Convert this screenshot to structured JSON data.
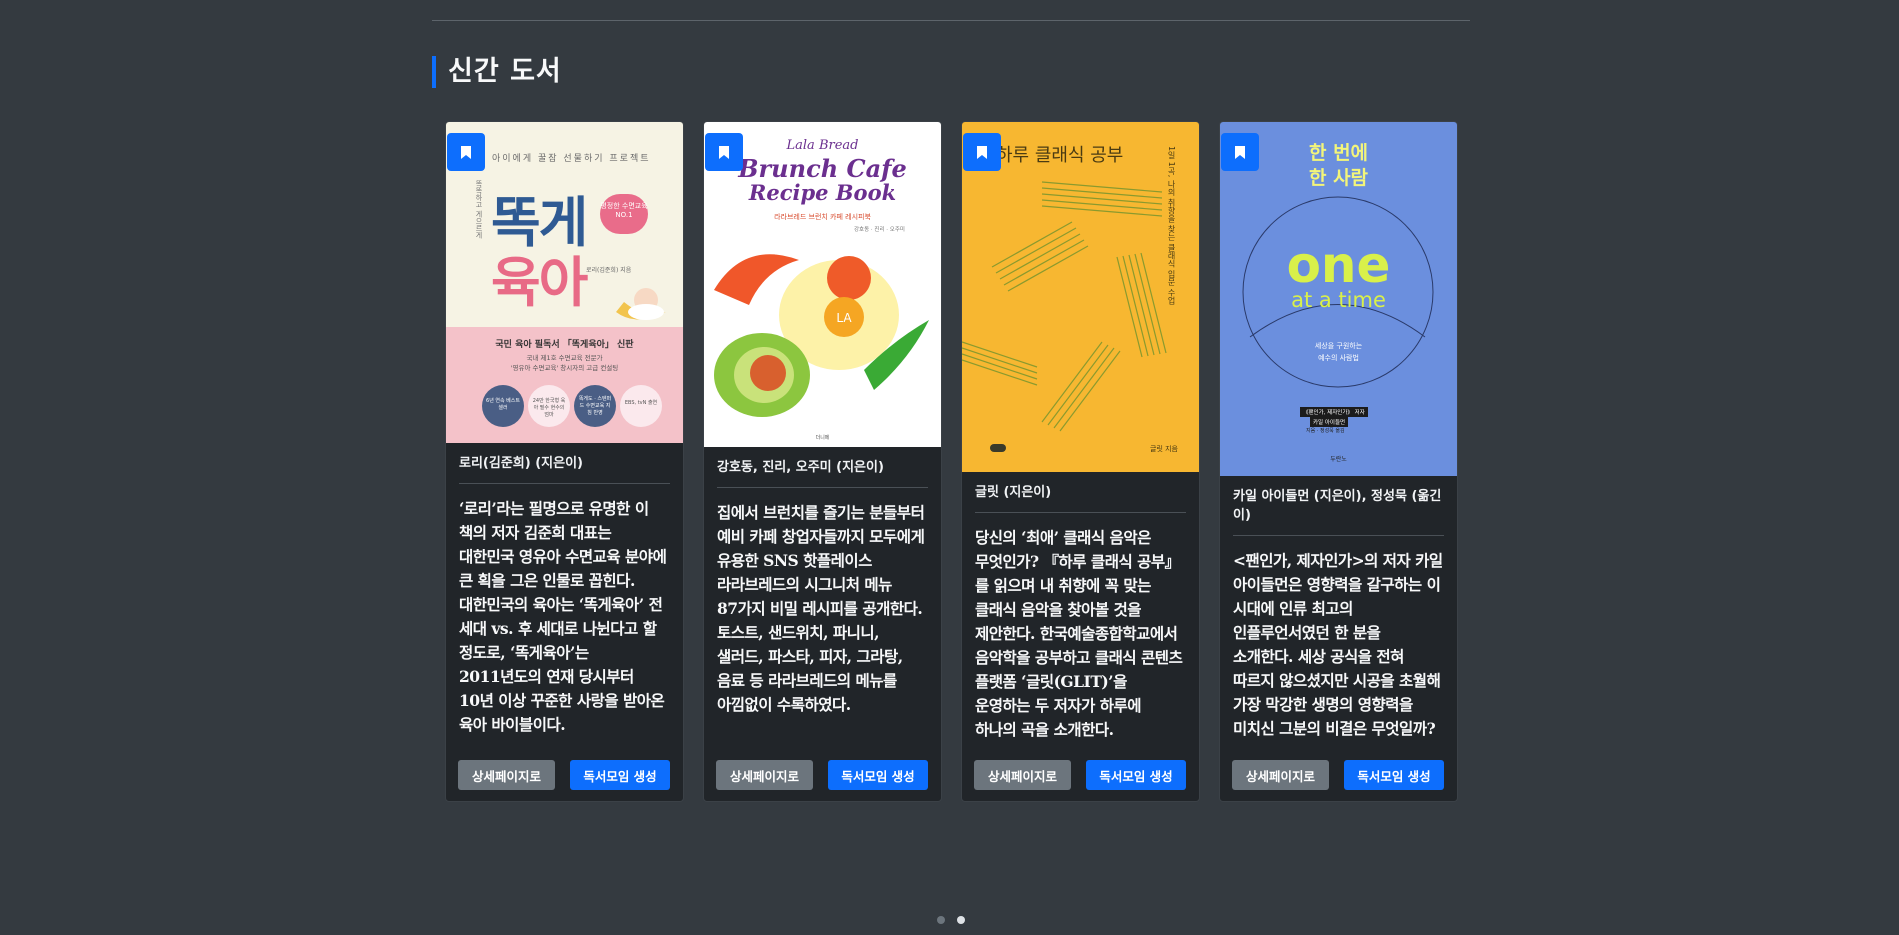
{
  "section": {
    "title": "신간 도서"
  },
  "colors": {
    "accent": "#0d6efd",
    "background": "#343a40",
    "card": "#212529"
  },
  "buttons": {
    "detail_label": "상세페이지로",
    "create_label": "독서모임 생성"
  },
  "icons": {
    "bookmark": "bookmark-icon"
  },
  "books": [
    {
      "cover": {
        "tagline": "아이에게 꿀잠 선물하기 프로젝트",
        "side_text": "똑똑하고 게으르게",
        "title_top": "똑게",
        "title_bottom": "육아",
        "badge": "평정한 수면교육 NO.1",
        "byline": "로리(김준희) 지음",
        "subtitle": "국민 육아 필독서 「똑게육아」 신판",
        "note_1": "국내 제1호 수면교육 전문가",
        "note_2": "'영유아 수면교육' 창시자의 고급 컨설팅",
        "seal_1": "6년 연속 베스트셀러",
        "seal_2": "24만 한국형 육아 필수 현수의 엄마",
        "seal_3": "똑게도 · 스텐퍼드 수면교육 지침 반영",
        "seal_4": "EBS, tvN 출연"
      },
      "author": "로리(김준희) (지은이)",
      "description": "‘로리’라는 필명으로 유명한 이 책의 저자 김준희 대표는 대한민국 영유아 수면교육 분야에 큰 획을 그은 인물로 꼽힌다. 대한민국의 육아는 ‘똑게육아’ 전 세대 vs. 후 세대로 나뉜다고 할 정도로, ‘똑게육아’는 2011년도의 연재 당시부터 10년 이상 꾸준한 사랑을 받아온 육아 바이블이다."
    },
    {
      "cover": {
        "brand": "Lala Bread",
        "title_1": "Brunch Cafe",
        "title_2": "Recipe Book",
        "subtitle": "라라브레드 브런치 카페 레시피북",
        "names": "강호동 · 진리 · 오주미",
        "egg_text": "LA",
        "publisher": "더니메"
      },
      "author": "강호동, 진리, 오주미 (지은이)",
      "description": "집에서 브런치를 즐기는 분들부터 예비 카페 창업자들까지 모두에게 유용한 SNS 핫플레이스 라라브레드의 시그니처 메뉴 87가지 비밀 레시피를 공개한다. 토스트, 샌드위치, 파니니, 샐러드, 파스타, 피자, 그라탕, 음료 등 라라브레드의 메뉴를 아낌없이 수록하였다."
    },
    {
      "cover": {
        "title": "하루 클래식 공부",
        "side_text": "1일 1곡, 나의 취향을 찾는 클래식 입문 수업",
        "author": "글릿 지음"
      },
      "author": "글릿 (지은이)",
      "description": "당신의 ‘최애’ 클래식 음악은 무엇인가? 『하루 클래식 공부』를 읽으며 내 취향에 꼭 맞는 클래식 음악을 찾아볼 것을 제안한다. 한국예술종합학교에서 음악학을 공부하고 클래식 콘텐츠 플랫폼 ‘글릿(GLIT)’을 운영하는 두 저자가 하루에 하나의 곡을 소개한다."
    },
    {
      "cover": {
        "title_1": "한 번에",
        "title_2": "한 사람",
        "big_1": "one",
        "big_2": "at a time",
        "sub_1": "세상을 구원하는",
        "sub_2": "예수의 사람법",
        "banner_1": "《팬인가, 제자인가》 저자",
        "banner_2": "카일 아이들먼",
        "banner_3": "지음 · 정성묵 옮김",
        "publisher": "두란노"
      },
      "author": "카일 아이들먼 (지은이), 정성묵 (옮긴이)",
      "description": "<팬인가, 제자인가>의 저자 카일 아이들먼은 영향력을 갈구하는 이 시대에 인류 최고의 인플루언서였던 한 분을 소개한다. 세상 공식을 전혀 따르지 않으셨지만 시공을 초월해 가장 막강한 생명의 영향력을 미치신 그분의 비결은 무엇일까?"
    }
  ],
  "pagination": {
    "pages": 2,
    "current": 2
  }
}
